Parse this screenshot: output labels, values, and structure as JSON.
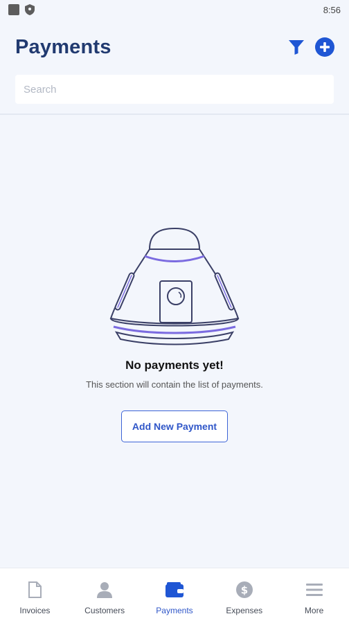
{
  "status_bar": {
    "time": "8:56",
    "icons": [
      "square-icon",
      "shield-icon"
    ]
  },
  "header": {
    "title": "Payments",
    "actions": [
      "filter-icon",
      "add-circle-icon"
    ]
  },
  "search": {
    "placeholder": "Search",
    "value": ""
  },
  "empty_state": {
    "illustration": "capsule-icon",
    "title": "No payments yet!",
    "description": "This section will contain the list of payments.",
    "button_label": "Add New Payment"
  },
  "bottom_nav": {
    "active": "Payments",
    "items": [
      {
        "label": "Invoices",
        "icon": "document-icon"
      },
      {
        "label": "Customers",
        "icon": "person-icon"
      },
      {
        "label": "Payments",
        "icon": "wallet-icon"
      },
      {
        "label": "Expenses",
        "icon": "dollar-icon"
      },
      {
        "label": "More",
        "icon": "menu-icon"
      }
    ]
  },
  "colors": {
    "background": "#f3f6fc",
    "title": "#213a70",
    "accent": "#2f56c8",
    "nav_inactive": "#a8adb8"
  }
}
